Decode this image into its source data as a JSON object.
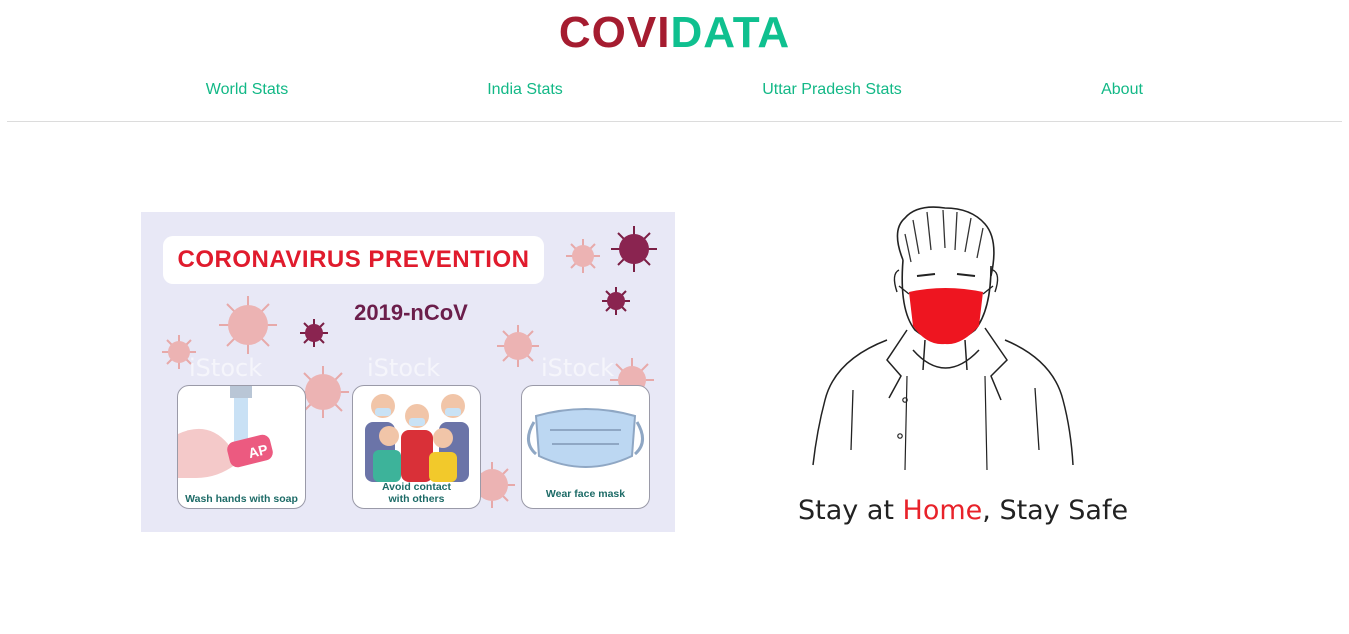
{
  "brand": {
    "part1": "COVI",
    "part2": "DATA",
    "color1": "#a51c30",
    "color2": "#0fc08f"
  },
  "nav": {
    "items": [
      {
        "label": "World Stats"
      },
      {
        "label": "India Stats"
      },
      {
        "label": "Uttar Pradesh Stats"
      },
      {
        "label": "About"
      }
    ],
    "color": "#12b886"
  },
  "poster": {
    "title": "CORONAVIRUS PREVENTION",
    "subtitle": "2019-nCoV",
    "watermark": "iStock",
    "cards": [
      {
        "label": "Wash hands with soap",
        "icon": "hand-washing-icon"
      },
      {
        "label_line1": "Avoid contact",
        "label_line2": "with others",
        "icon": "masked-people-icon"
      },
      {
        "label": "Wear face mask",
        "icon": "face-mask-icon"
      }
    ]
  },
  "illustration": {
    "tagline_part1": "Stay at ",
    "tagline_highlight": "Home",
    "tagline_part2": ", Stay Safe",
    "highlight_color": "#e8222a"
  }
}
